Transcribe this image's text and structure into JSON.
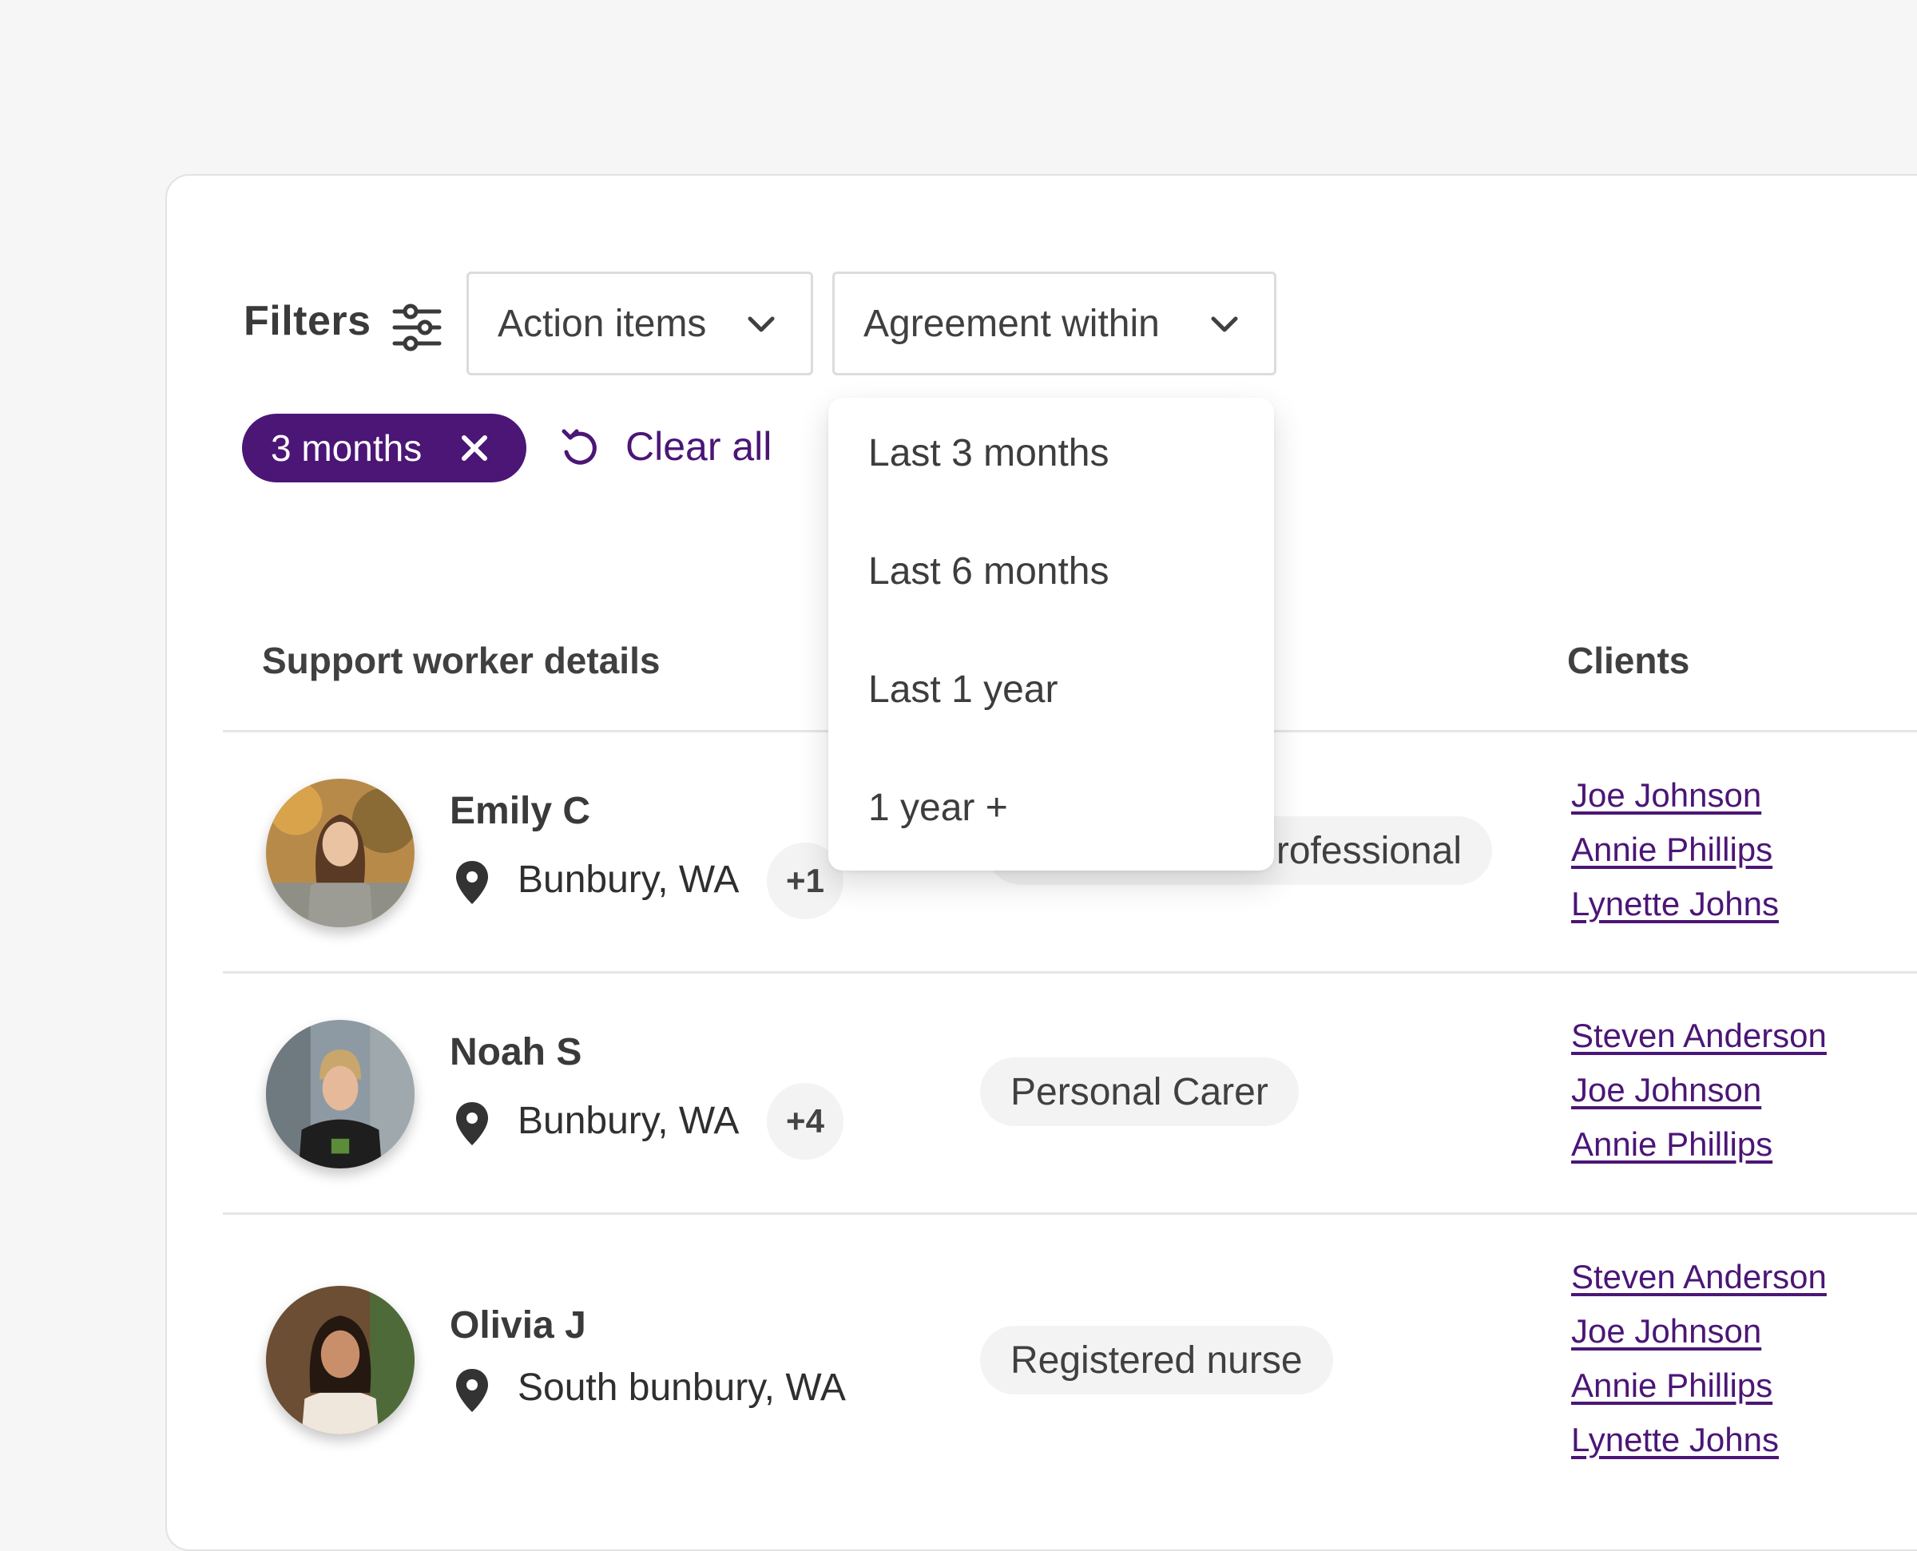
{
  "filters": {
    "label": "Filters",
    "selects": [
      {
        "label": "Action items"
      },
      {
        "label": "Agreement within"
      }
    ],
    "active_chip": "3 months",
    "clear_all": "Clear all"
  },
  "dropdown": {
    "options": [
      "Last 3 months",
      "Last 6 months",
      "Last 1 year",
      "1 year +"
    ]
  },
  "table": {
    "headers": {
      "details": "Support worker details",
      "clients": "Clients"
    },
    "rows": [
      {
        "name": "Emily C",
        "location": "Bunbury, WA",
        "extra": "+1",
        "role": "rofessional",
        "clients": [
          "Joe Johnson",
          "Annie Phillips",
          "Lynette Johns"
        ]
      },
      {
        "name": "Noah S",
        "location": "Bunbury, WA",
        "extra": "+4",
        "role": "Personal Carer",
        "clients": [
          "Steven Anderson",
          "Joe Johnson",
          "Annie Phillips"
        ]
      },
      {
        "name": "Olivia J",
        "location": "South bunbury, WA",
        "extra": "",
        "role": "Registered nurse",
        "clients": [
          "Steven Anderson",
          "Joe Johnson",
          "Annie Phillips",
          "Lynette Johns"
        ]
      }
    ]
  },
  "colors": {
    "accent": "#4b1676",
    "background": "#f6f6f6",
    "card": "#ffffff",
    "pill": "#f3f3f3"
  }
}
